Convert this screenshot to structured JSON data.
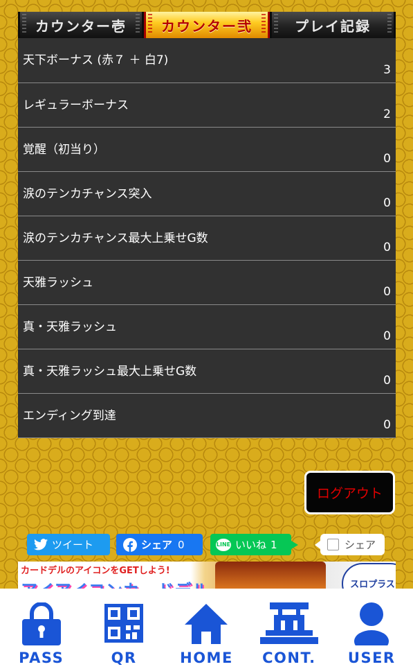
{
  "tabs": [
    {
      "label": "カウンター壱",
      "active": false
    },
    {
      "label": "カウンター弐",
      "active": true
    },
    {
      "label": "プレイ記録",
      "active": false
    }
  ],
  "counters": [
    {
      "label": "天下ボーナス (赤７ ＋ 白7)",
      "value": "3"
    },
    {
      "label": "レギュラーボーナス",
      "value": "2"
    },
    {
      "label": "覚醒（初当り）",
      "value": "0"
    },
    {
      "label": "涙のテンカチャンス突入",
      "value": "0"
    },
    {
      "label": "涙のテンカチャンス最大上乗せG数",
      "value": "0"
    },
    {
      "label": "天雅ラッシュ",
      "value": "0"
    },
    {
      "label": "真・天雅ラッシュ",
      "value": "0"
    },
    {
      "label": "真・天雅ラッシュ最大上乗せG数",
      "value": "0"
    },
    {
      "label": "エンディング到達",
      "value": "0"
    }
  ],
  "logout_label": "ログアウト",
  "social": {
    "tweet": "ツイート",
    "facebook": "シェア",
    "facebook_count": "0",
    "line": "いいね",
    "line_count": "1",
    "share": "シェア"
  },
  "banner": {
    "headline": "カードデルのアイコンをGETしよう!",
    "title": "アイアイコンカードデル",
    "badge": "スロプラス+"
  },
  "nav": [
    {
      "label": "PASS",
      "icon": "lock-icon"
    },
    {
      "label": "QR",
      "icon": "qr-code-icon"
    },
    {
      "label": "HOME",
      "icon": "home-icon"
    },
    {
      "label": "CONT.",
      "icon": "castle-icon"
    },
    {
      "label": "USER",
      "icon": "user-icon"
    }
  ],
  "colors": {
    "background": "#d9ac1c",
    "row_bg": "#313131",
    "nav_accent": "#1a55d6",
    "logout_text": "#e10000"
  }
}
